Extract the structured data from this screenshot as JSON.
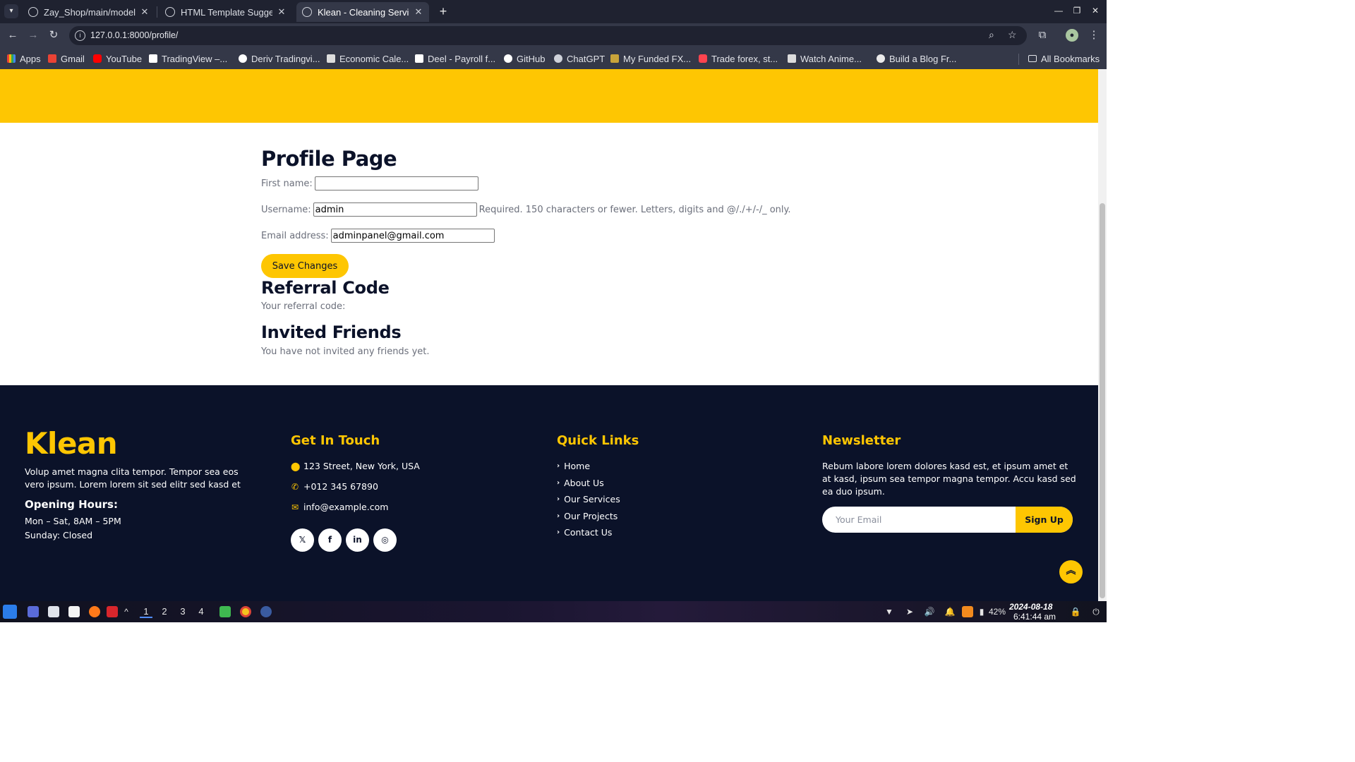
{
  "browser": {
    "tabs": [
      {
        "title": "Zay_Shop/main/models.py",
        "active": false
      },
      {
        "title": "HTML Template Suggesti",
        "active": false
      },
      {
        "title": "Klean - Cleaning Services",
        "active": true
      }
    ],
    "url": "127.0.0.1:8000/profile/",
    "bookmarks": [
      {
        "label": "Apps",
        "icon": "apps-grid-icon"
      },
      {
        "label": "Gmail",
        "icon": "gmail-icon"
      },
      {
        "label": "YouTube",
        "icon": "youtube-icon"
      },
      {
        "label": "TradingView –...",
        "icon": "tradingview-icon"
      },
      {
        "label": "Deriv Tradingvi...",
        "icon": "deriv-icon"
      },
      {
        "label": "Economic Cale...",
        "icon": "investing-icon"
      },
      {
        "label": "Deel - Payroll f...",
        "icon": "deel-icon"
      },
      {
        "label": "GitHub",
        "icon": "github-icon"
      },
      {
        "label": "ChatGPT",
        "icon": "chatgpt-icon"
      },
      {
        "label": "My Funded FX...",
        "icon": "myfundedfx-icon"
      },
      {
        "label": "Trade forex, st...",
        "icon": "deriv-red-icon"
      },
      {
        "label": "Watch Anime...",
        "icon": "anime-icon"
      },
      {
        "label": "Build a Blog Fr...",
        "icon": "blog-icon"
      }
    ],
    "all_bookmarks": "All Bookmarks"
  },
  "profile": {
    "title": "Profile Page",
    "first_name_label": "First name:",
    "first_name_value": "",
    "username_label": "Username:",
    "username_value": "admin",
    "username_help": "Required. 150 characters or fewer. Letters, digits and @/./+/-/_ only.",
    "email_label": "Email address:",
    "email_value": "adminpanel@gmail.com",
    "save_button": "Save Changes"
  },
  "referral": {
    "title": "Referral Code",
    "text": "Your referral code:"
  },
  "invited": {
    "title": "Invited Friends",
    "text": "You have not invited any friends yet."
  },
  "footer": {
    "brand": "Klean",
    "about": "Volup amet magna clita tempor. Tempor sea eos vero ipsum. Lorem lorem sit sed elitr sed kasd et",
    "hours_title": "Opening Hours:",
    "hours_weekdays": "Mon – Sat, 8AM – 5PM",
    "hours_sunday": "Sunday: Closed",
    "contact": {
      "title": "Get In Touch",
      "address": "123 Street, New York, USA",
      "phone": "+012 345 67890",
      "email": "info@example.com"
    },
    "social": [
      "twitter-icon",
      "facebook-icon",
      "linkedin-icon",
      "instagram-icon"
    ],
    "quick_links": {
      "title": "Quick Links",
      "items": [
        "Home",
        "About Us",
        "Our Services",
        "Our Projects",
        "Contact Us"
      ]
    },
    "newsletter": {
      "title": "Newsletter",
      "text": "Rebum labore lorem dolores kasd est, et ipsum amet et at kasd, ipsum sea tempor magna tempor. Accu kasd sed ea duo ipsum.",
      "placeholder": "Your Email",
      "button": "Sign Up"
    }
  },
  "taskbar": {
    "workspaces": [
      "1",
      "2",
      "3",
      "4"
    ],
    "battery": "42%",
    "date": "2024-08-18",
    "time": "6:41:44 am"
  },
  "colors": {
    "accent": "#fec602",
    "dark": "#0b1229",
    "text_muted": "#6b6f7b"
  }
}
